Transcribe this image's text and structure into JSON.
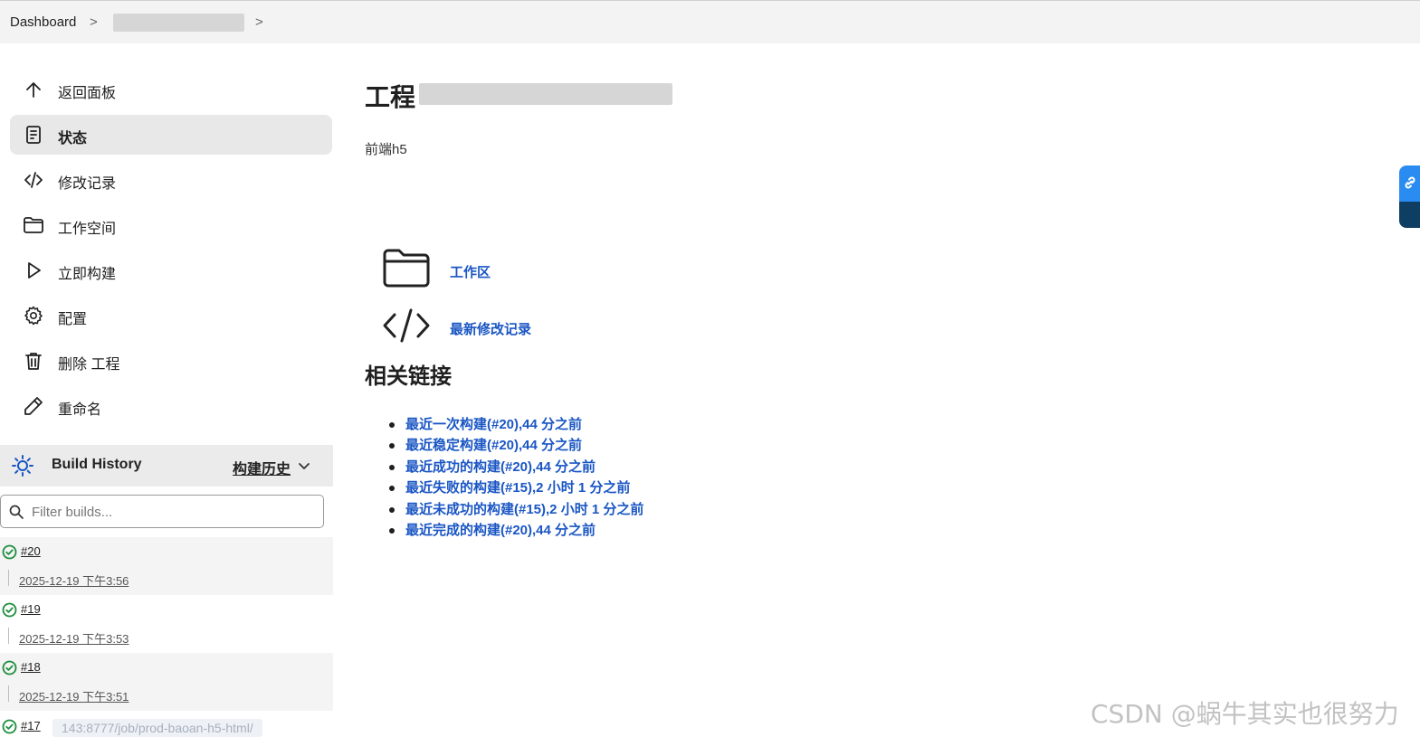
{
  "breadcrumb": {
    "dashboard": "Dashboard",
    "separator": ">"
  },
  "sidebar": {
    "tasks": [
      {
        "label": "返回面板",
        "icon": "arrow-up-icon"
      },
      {
        "label": "状态",
        "icon": "document-icon"
      },
      {
        "label": "修改记录",
        "icon": "code-icon"
      },
      {
        "label": "工作空间",
        "icon": "folder-icon"
      },
      {
        "label": "立即构建",
        "icon": "play-icon"
      },
      {
        "label": "配置",
        "icon": "gear-icon"
      },
      {
        "label": "删除 工程",
        "icon": "trash-icon"
      },
      {
        "label": "重命名",
        "icon": "pencil-icon"
      }
    ]
  },
  "build_history": {
    "title": "Build History",
    "trend": "构建历史",
    "filter_placeholder": "Filter builds...",
    "builds": [
      {
        "number": "#20",
        "date": "2025-12-19 下午3:56"
      },
      {
        "number": "#19",
        "date": "2025-12-19 下午3:53"
      },
      {
        "number": "#18",
        "date": "2025-12-19 下午3:51"
      },
      {
        "number": "#17",
        "date": ""
      }
    ],
    "status_url": "143:8777/job/prod-baoan-h5-html/"
  },
  "main": {
    "title_prefix": "工程",
    "description": "前端h5",
    "workspace_link": "工作区",
    "changes_link": "最新修改记录",
    "related_heading": "相关链接",
    "permalinks": [
      "最近一次构建(#20),44 分之前",
      "最近稳定构建(#20),44 分之前",
      "最近成功的构建(#20),44 分之前",
      "最近失败的构建(#15),2 小时 1 分之前",
      "最近未成功的构建(#15),2 小时 1 分之前",
      "最近完成的构建(#20),44 分之前"
    ]
  },
  "watermark": "CSDN @蜗牛其实也很努力",
  "colors": {
    "link": "#1a56c4",
    "success": "#1e8e3e",
    "active_task_bg": "#e8e8e8"
  }
}
